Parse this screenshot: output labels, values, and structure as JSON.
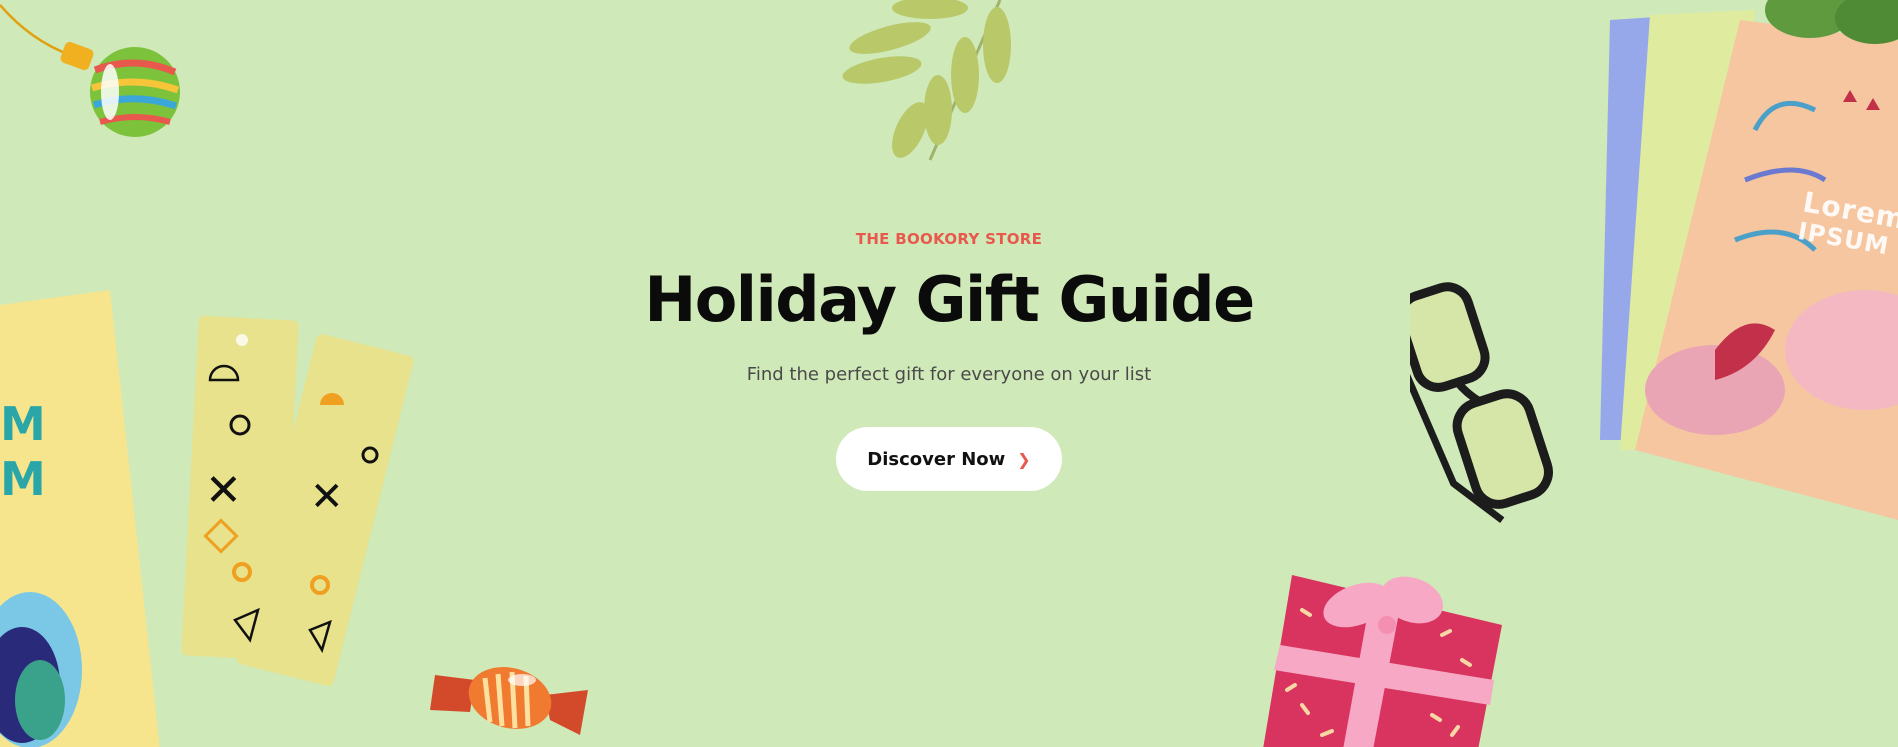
{
  "hero": {
    "eyebrow": "THE BOOKORY STORE",
    "title": "Holiday Gift Guide",
    "subtitle": "Find the perfect gift for everyone on your list",
    "cta_label": "Discover Now",
    "cta_icon": "chevron-right-icon",
    "background": "#d0e9b9",
    "accent": "#e8584d"
  },
  "decorations": {
    "notebook_cover_text_line1": "Lorem",
    "notebook_cover_text_line2": "IPSUM"
  }
}
